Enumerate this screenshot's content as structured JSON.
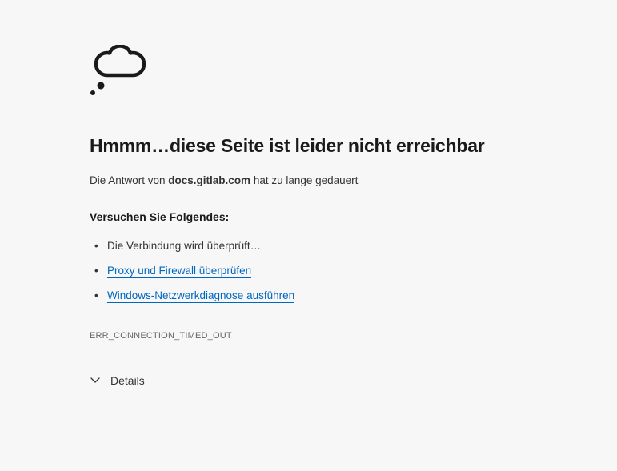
{
  "title": "Hmmm…diese Seite ist leider nicht erreichbar",
  "subtitle_prefix": "Die Antwort von ",
  "subtitle_host": "docs.gitlab.com",
  "subtitle_suffix": " hat zu lange gedauert",
  "suggest_heading": "Versuchen Sie Folgendes:",
  "suggestions": {
    "item0": "Die Verbindung wird überprüft…",
    "item1": "Proxy und Firewall überprüfen",
    "item2": "Windows-Netzwerkdiagnose ausführen"
  },
  "error_code": "ERR_CONNECTION_TIMED_OUT",
  "details_label": "Details"
}
